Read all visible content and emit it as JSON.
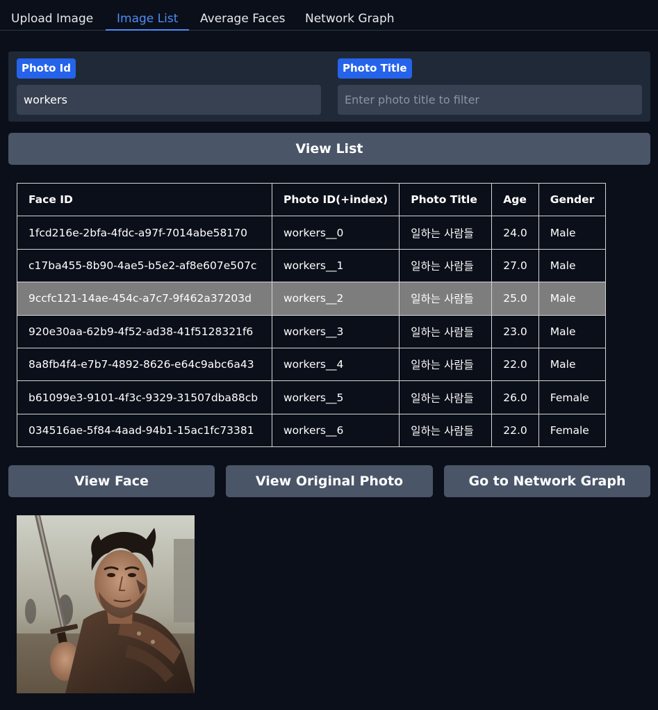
{
  "tabs": [
    {
      "label": "Upload Image",
      "active": false
    },
    {
      "label": "Image List",
      "active": true
    },
    {
      "label": "Average Faces",
      "active": false
    },
    {
      "label": "Network Graph",
      "active": false
    }
  ],
  "filters": {
    "photo_id": {
      "label": "Photo Id",
      "value": "workers",
      "placeholder": ""
    },
    "photo_title": {
      "label": "Photo Title",
      "value": "",
      "placeholder": "Enter photo title to filter"
    }
  },
  "view_list_label": "View List",
  "table": {
    "columns": [
      "Face ID",
      "Photo ID(+index)",
      "Photo Title",
      "Age",
      "Gender"
    ],
    "rows": [
      [
        "1fcd216e-2bfa-4fdc-a97f-7014abe58170",
        "workers__0",
        "일하는 사람들",
        "24.0",
        "Male"
      ],
      [
        "c17ba455-8b90-4ae5-b5e2-af8e607e507c",
        "workers__1",
        "일하는 사람들",
        "27.0",
        "Male"
      ],
      [
        "9ccfc121-14ae-454c-a7c7-9f462a37203d",
        "workers__2",
        "일하는 사람들",
        "25.0",
        "Male"
      ],
      [
        "920e30aa-62b9-4f52-ad38-41f5128321f6",
        "workers__3",
        "일하는 사람들",
        "23.0",
        "Male"
      ],
      [
        "8a8fb4f4-e7b7-4892-8626-e64c9abc6a43",
        "workers__4",
        "일하는 사람들",
        "22.0",
        "Male"
      ],
      [
        "b61099e3-9101-4f3c-9329-31507dba88cb",
        "workers__5",
        "일하는 사람들",
        "26.0",
        "Female"
      ],
      [
        "034516ae-5f84-4aad-94b1-15ac1fc73381",
        "workers__6",
        "일하는 사람들",
        "22.0",
        "Female"
      ]
    ],
    "selected_row": 2
  },
  "actions": {
    "view_face": "View Face",
    "view_original": "View Original Photo",
    "network_graph": "Go to Network Graph"
  },
  "colors": {
    "background": "#0b0f19",
    "panel": "#1f2937",
    "accent": "#2563eb",
    "tab_active": "#4c8df6",
    "button": "#4a5568",
    "selected_row": "#7d7d7d"
  }
}
